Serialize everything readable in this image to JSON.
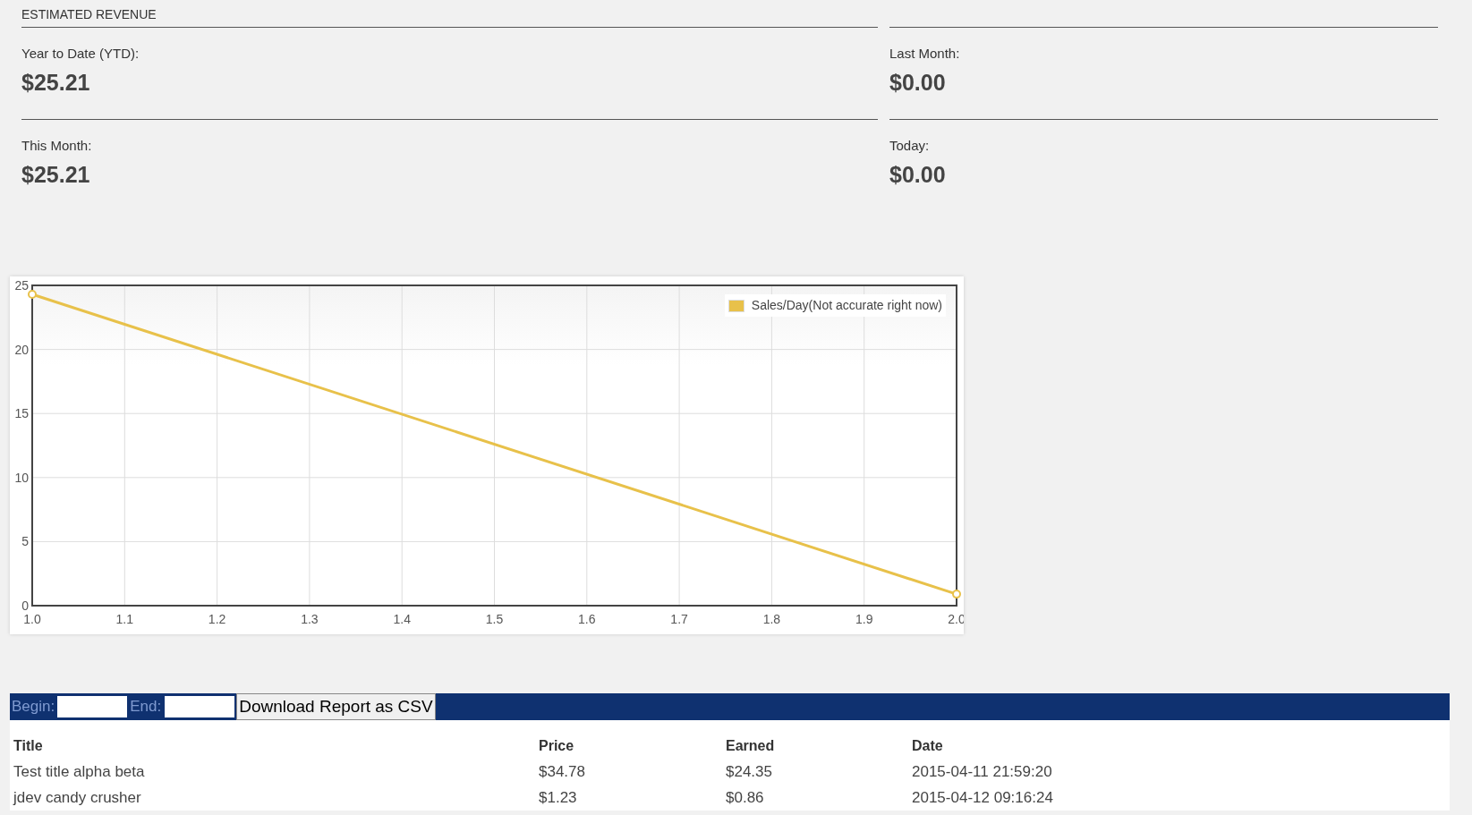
{
  "section_title": "ESTIMATED REVENUE",
  "stats": [
    {
      "label": "Year to Date (YTD):",
      "value": "$25.21"
    },
    {
      "label": "Last Month:",
      "value": "$0.00"
    },
    {
      "label": "This Month:",
      "value": "$25.21"
    },
    {
      "label": "Today:",
      "value": "$0.00"
    }
  ],
  "chart": {
    "chart_data": {
      "type": "line",
      "x": [
        1.0,
        2.0
      ],
      "series": [
        {
          "name": "Sales/Day(Not accurate right now)",
          "color": "#e8c14a",
          "values": [
            24.3,
            0.9
          ]
        }
      ],
      "xlim": [
        1.0,
        2.0
      ],
      "ylim": [
        0,
        25
      ],
      "xticks": [
        {
          "value": 1.0,
          "label": "1.0"
        },
        {
          "value": 1.1,
          "label": "1.1"
        },
        {
          "value": 1.2,
          "label": "1.2"
        },
        {
          "value": 1.3,
          "label": "1.3"
        },
        {
          "value": 1.4,
          "label": "1.4"
        },
        {
          "value": 1.5,
          "label": "1.5"
        },
        {
          "value": 1.6,
          "label": "1.6"
        },
        {
          "value": 1.7,
          "label": "1.7"
        },
        {
          "value": 1.8,
          "label": "1.8"
        },
        {
          "value": 1.9,
          "label": "1.9"
        },
        {
          "value": 2.0,
          "label": "2.0"
        }
      ],
      "yticks": [
        0,
        5,
        10,
        15,
        20,
        25
      ],
      "grid": true,
      "marker": true
    }
  },
  "report_bar": {
    "begin_label": "Begin:",
    "end_label": "End:",
    "download_button": "Download Report as CSV"
  },
  "table": {
    "columns": [
      "Title",
      "Price",
      "Earned",
      "Date"
    ],
    "rows": [
      [
        "Test title alpha beta",
        "$34.78",
        "$24.35",
        "2015-04-11 21:59:20"
      ],
      [
        "jdev candy crusher",
        "$1.23",
        "$0.86",
        "2015-04-12 09:16:24"
      ]
    ]
  }
}
